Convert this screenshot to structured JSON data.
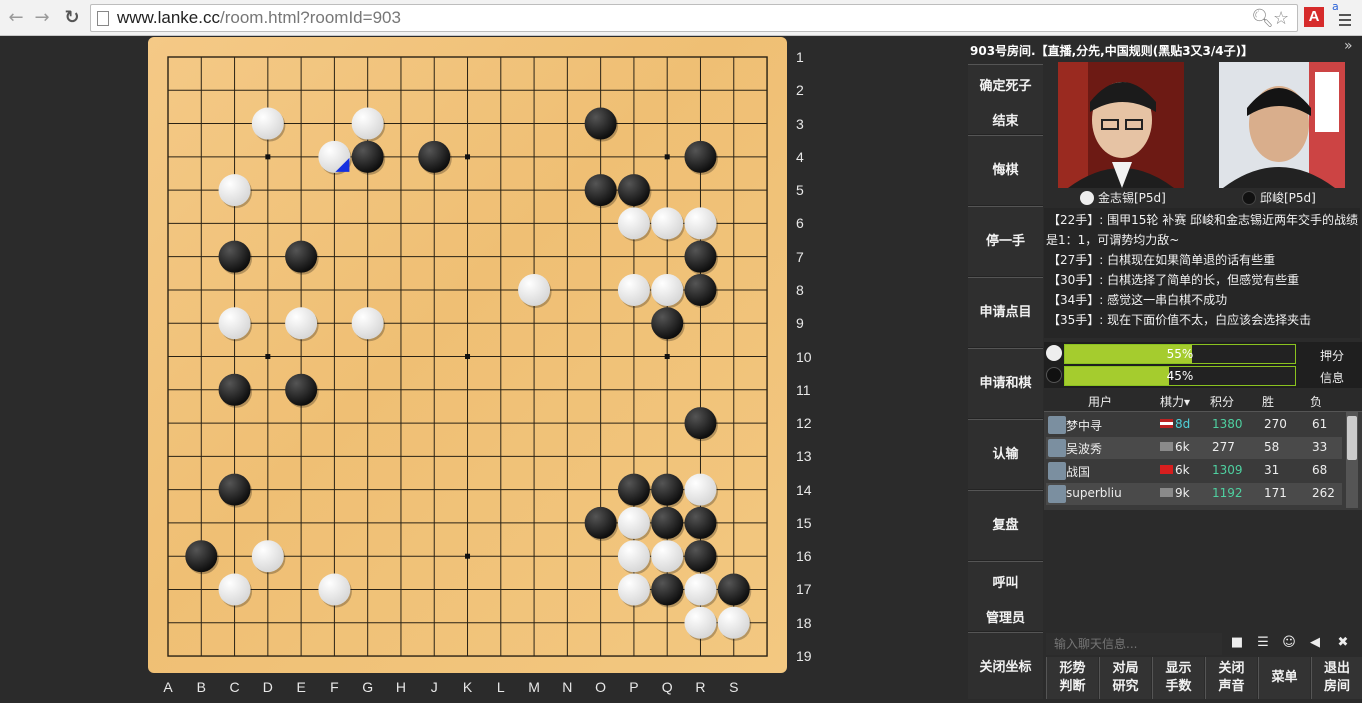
{
  "browser": {
    "url_host": "www.lanke.cc",
    "url_path": "/room.html?roomId=903",
    "back_label": "←",
    "forward_label": "→",
    "reload_label": "↻",
    "ext_label": "A",
    "ext2_label": "a"
  },
  "board": {
    "size": 19,
    "row_labels": [
      "1",
      "2",
      "3",
      "4",
      "5",
      "6",
      "7",
      "8",
      "9",
      "10",
      "11",
      "12",
      "13",
      "14",
      "15",
      "16",
      "17",
      "18",
      "19"
    ],
    "col_labels": [
      "A",
      "B",
      "C",
      "D",
      "E",
      "F",
      "G",
      "H",
      "J",
      "K",
      "L",
      "M",
      "N",
      "O",
      "P",
      "Q",
      "R",
      "S"
    ],
    "stones": [
      {
        "c": "w",
        "x": 3,
        "y": 3
      },
      {
        "c": "w",
        "x": 6,
        "y": 3
      },
      {
        "c": "b",
        "x": 13,
        "y": 3
      },
      {
        "c": "w",
        "x": 5,
        "y": 4,
        "last": true
      },
      {
        "c": "b",
        "x": 6,
        "y": 4
      },
      {
        "c": "b",
        "x": 8,
        "y": 4
      },
      {
        "c": "b",
        "x": 16,
        "y": 4
      },
      {
        "c": "w",
        "x": 2,
        "y": 5
      },
      {
        "c": "b",
        "x": 13,
        "y": 5
      },
      {
        "c": "b",
        "x": 14,
        "y": 5
      },
      {
        "c": "w",
        "x": 14,
        "y": 6
      },
      {
        "c": "w",
        "x": 15,
        "y": 6
      },
      {
        "c": "w",
        "x": 16,
        "y": 6
      },
      {
        "c": "b",
        "x": 2,
        "y": 7
      },
      {
        "c": "b",
        "x": 4,
        "y": 7
      },
      {
        "c": "b",
        "x": 16,
        "y": 7
      },
      {
        "c": "w",
        "x": 11,
        "y": 8
      },
      {
        "c": "w",
        "x": 14,
        "y": 8
      },
      {
        "c": "w",
        "x": 15,
        "y": 8
      },
      {
        "c": "b",
        "x": 16,
        "y": 8
      },
      {
        "c": "w",
        "x": 2,
        "y": 9
      },
      {
        "c": "w",
        "x": 4,
        "y": 9
      },
      {
        "c": "w",
        "x": 6,
        "y": 9
      },
      {
        "c": "b",
        "x": 15,
        "y": 9
      },
      {
        "c": "b",
        "x": 2,
        "y": 11
      },
      {
        "c": "b",
        "x": 4,
        "y": 11
      },
      {
        "c": "b",
        "x": 16,
        "y": 12
      },
      {
        "c": "b",
        "x": 2,
        "y": 14
      },
      {
        "c": "b",
        "x": 14,
        "y": 14
      },
      {
        "c": "b",
        "x": 15,
        "y": 14
      },
      {
        "c": "w",
        "x": 16,
        "y": 14
      },
      {
        "c": "b",
        "x": 13,
        "y": 15
      },
      {
        "c": "w",
        "x": 14,
        "y": 15
      },
      {
        "c": "b",
        "x": 15,
        "y": 15
      },
      {
        "c": "b",
        "x": 16,
        "y": 15
      },
      {
        "c": "b",
        "x": 1,
        "y": 16
      },
      {
        "c": "w",
        "x": 3,
        "y": 16
      },
      {
        "c": "w",
        "x": 14,
        "y": 16
      },
      {
        "c": "w",
        "x": 15,
        "y": 16
      },
      {
        "c": "b",
        "x": 16,
        "y": 16
      },
      {
        "c": "w",
        "x": 2,
        "y": 17
      },
      {
        "c": "w",
        "x": 5,
        "y": 17
      },
      {
        "c": "w",
        "x": 14,
        "y": 17
      },
      {
        "c": "b",
        "x": 15,
        "y": 17
      },
      {
        "c": "w",
        "x": 16,
        "y": 17
      },
      {
        "c": "b",
        "x": 17,
        "y": 17
      },
      {
        "c": "w",
        "x": 16,
        "y": 18
      },
      {
        "c": "w",
        "x": 17,
        "y": 18
      }
    ],
    "star_points": [
      [
        3,
        4
      ],
      [
        9,
        4
      ],
      [
        15,
        4
      ],
      [
        3,
        10
      ],
      [
        9,
        10
      ],
      [
        15,
        10
      ],
      [
        9,
        16
      ]
    ]
  },
  "room": {
    "title": "903号房间.【直播,分先,中国规则(黑贴3又3/4子)】",
    "collapse_label": "»"
  },
  "menu": {
    "confirm_dead_1": "确定死子",
    "confirm_dead_2": "结束",
    "undo": "悔棋",
    "pass": "停一手",
    "count": "申请点目",
    "draw": "申请和棋",
    "resign": "认输",
    "review": "复盘",
    "call_admin_1": "呼叫",
    "call_admin_2": "管理员",
    "close_coords": "关闭坐标"
  },
  "players": {
    "white_name": "金志锡[P5d]",
    "black_name": "邱峻[P5d]"
  },
  "comments": [
    "【22手】: 围甲15轮 补赛 邱峻和金志锡近两年交手的战绩",
    "是1：1，可谓势均力敌~",
    "【27手】: 白棋现在如果简单退的话有些重",
    "【30手】: 白棋选择了简单的长，但感觉有些重",
    "【34手】: 感觉这一串白棋不成功",
    "【35手】: 现在下面价值不太，白应该会选择夹击"
  ],
  "bet": {
    "white_pct": 55,
    "black_pct": 45,
    "white_label": "55%",
    "black_label": "45%",
    "bet_label": "押分",
    "info_label": "信息"
  },
  "users": {
    "headers": {
      "user": "用户",
      "rank": "棋力",
      "rank_arrow": "▾",
      "score": "积分",
      "wins": "胜",
      "losses": "负"
    },
    "rows": [
      {
        "name": "梦中寻",
        "rank": "8d",
        "score": "1380",
        "wins": "270",
        "losses": "61",
        "rank_color": "#4fd0d8",
        "score_color": "#4fd0a0",
        "flag": "us"
      },
      {
        "name": "吴波秀",
        "rank": "6k",
        "score": "277",
        "wins": "58",
        "losses": "33",
        "rank_color": "#eeeeee",
        "score_color": "#eeeeee",
        "flag": "unknown"
      },
      {
        "name": "战国",
        "rank": "6k",
        "score": "1309",
        "wins": "31",
        "losses": "68",
        "rank_color": "#eeeeee",
        "score_color": "#4fd0a0",
        "flag": "cn"
      },
      {
        "name": "superbliu",
        "rank": "9k",
        "score": "1192",
        "wins": "171",
        "losses": "262",
        "rank_color": "#eeeeee",
        "score_color": "#4fd0a0",
        "flag": "unknown"
      }
    ]
  },
  "chat": {
    "placeholder": "输入聊天信息..."
  },
  "bottom": {
    "b1a": "形势",
    "b1b": "判断",
    "b2a": "对局",
    "b2b": "研究",
    "b3a": "显示",
    "b3b": "手数",
    "b4a": "关闭",
    "b4b": "声音",
    "b5": "菜单",
    "b6a": "退出",
    "b6b": "房间"
  }
}
